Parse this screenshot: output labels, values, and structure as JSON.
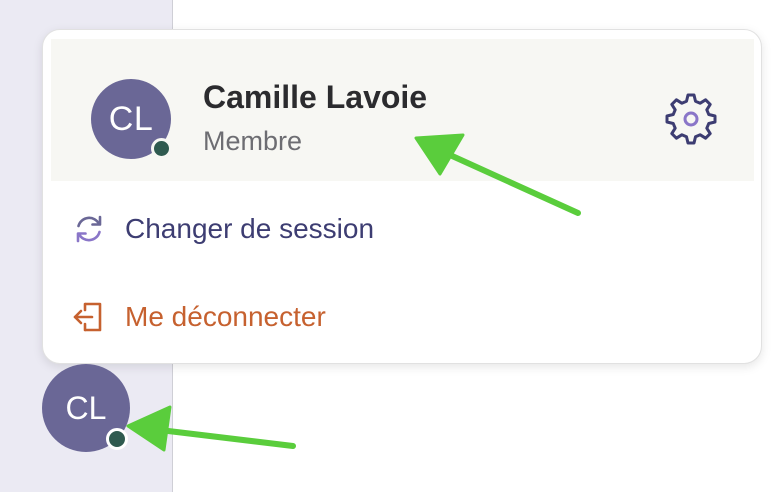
{
  "user": {
    "initials": "CL",
    "name": "Camille Lavoie",
    "role": "Membre",
    "status": "online",
    "avatar_color": "#6a6796",
    "status_color": "#2f5a4f"
  },
  "menu": {
    "switch_session_label": "Changer de session",
    "switch_session_icon": "refresh-icon",
    "logout_label": "Me déconnecter",
    "logout_icon": "logout-door-icon",
    "settings_icon": "gear-icon"
  },
  "sidebar": {
    "avatar_initials": "CL"
  },
  "colors": {
    "primary_text": "#3d3d72",
    "danger_text": "#c6612f",
    "annotation_arrow": "#5acd3c",
    "header_bg": "#f7f7f3",
    "sidebar_bg": "#ebeaf3"
  },
  "annotations": {
    "arrow_count": 2
  }
}
